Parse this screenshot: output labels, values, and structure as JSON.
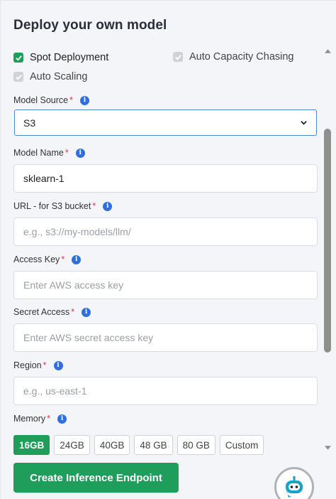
{
  "title": "Deploy your own model",
  "checkboxes": {
    "spot": {
      "label": "Spot Deployment",
      "checked": true
    },
    "capacity": {
      "label": "Auto Capacity Chasing",
      "checked": true,
      "disabled": true
    },
    "scaling": {
      "label": "Auto Scaling",
      "checked": true,
      "disabled": true
    }
  },
  "fields": {
    "model_source": {
      "label": "Model Source",
      "value": "S3"
    },
    "model_name": {
      "label": "Model Name",
      "value": "sklearn-1"
    },
    "url": {
      "label": "URL - for S3 bucket",
      "placeholder": "e.g., s3://my-models/llm/"
    },
    "access_key": {
      "label": "Access Key",
      "placeholder": "Enter AWS access key"
    },
    "secret_access": {
      "label": "Secret Access",
      "placeholder": "Enter AWS secret access key"
    },
    "region": {
      "label": "Region",
      "placeholder": "e.g., us-east-1"
    }
  },
  "memory": {
    "label": "Memory",
    "options": [
      "16GB",
      "24GB",
      "40GB",
      "48 GB",
      "80 GB",
      "Custom"
    ],
    "selected": "16GB"
  },
  "required_mark": "*",
  "info_glyph": "i",
  "create_button": "Create Inference Endpoint",
  "colors": {
    "accent": "#1e9e5a",
    "info": "#2f6fe0",
    "required": "#e53935"
  }
}
